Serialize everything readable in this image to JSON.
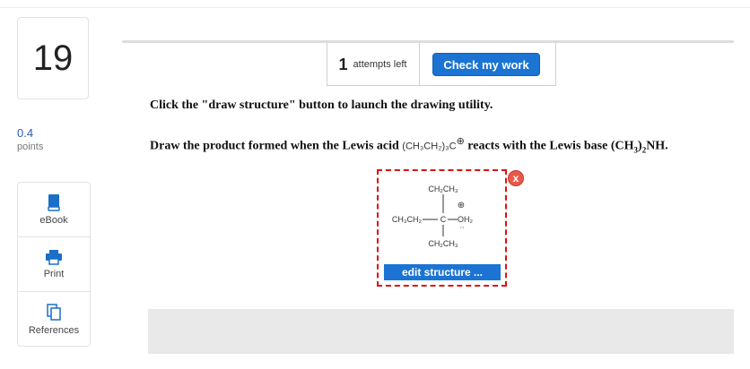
{
  "question": {
    "number": "19",
    "points_value": "0.4",
    "points_label": "points"
  },
  "tools": [
    {
      "label": "eBook",
      "icon": "book-icon"
    },
    {
      "label": "Print",
      "icon": "printer-icon"
    },
    {
      "label": "References",
      "icon": "references-icon"
    }
  ],
  "attempts": {
    "count": "1",
    "label": "attempts left",
    "check_button": "Check my work"
  },
  "prompt": {
    "instruction": "Click the \"draw structure\" button to launch the drawing utility.",
    "part1": "Draw the product formed when the Lewis acid ",
    "acid_formula": "(CH₃CH₂)₃C",
    "acid_charge": "⊕",
    "part2": " reacts with the Lewis base (CH",
    "sub3": "3",
    "part3": ")",
    "sub2": "2",
    "part4": "NH."
  },
  "structure": {
    "top_group": "CH₂CH₃",
    "left_group": "CH₃CH₂",
    "center_atom": "C",
    "right_group": "OH₂",
    "charge": "⊕",
    "lone_pair": "··",
    "bottom_group": "CH₂CH₃",
    "edit_button": "edit structure ...",
    "close_label": "x"
  },
  "colors": {
    "accent_blue": "#1b74d3",
    "points_blue": "#2a5db0",
    "dashed_red": "#dd1111",
    "close_red": "#e8594a"
  }
}
